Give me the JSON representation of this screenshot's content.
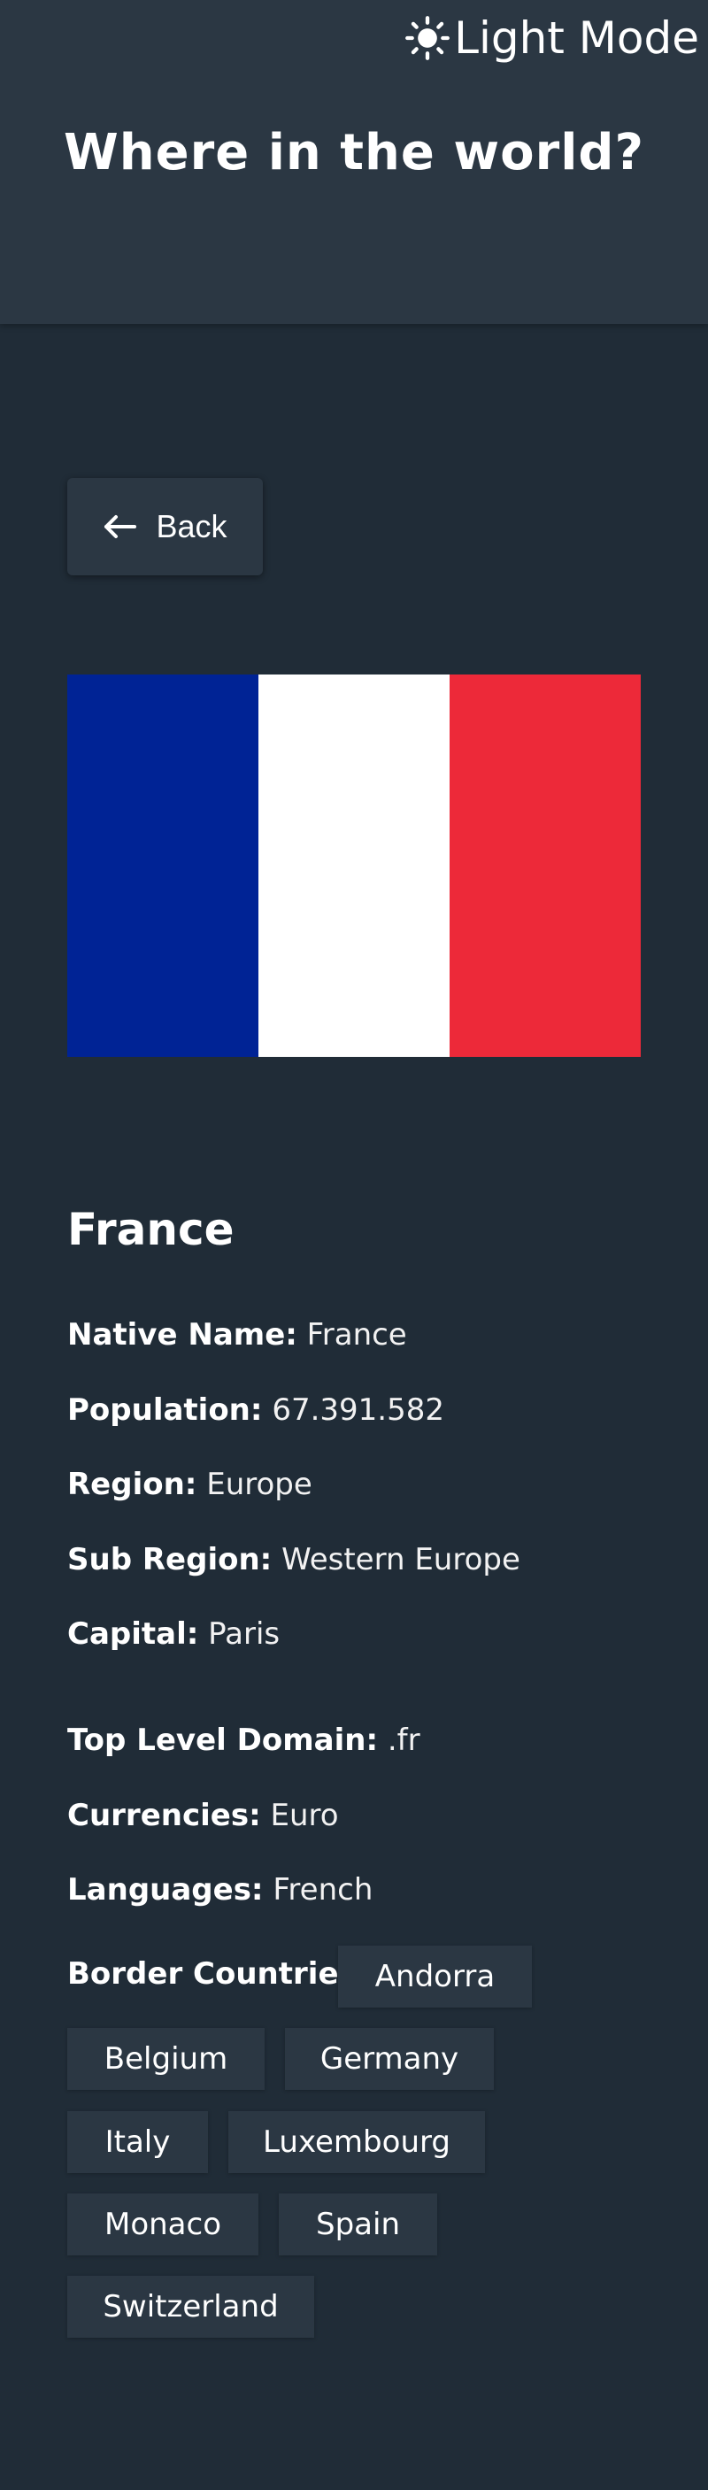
{
  "header": {
    "theme_toggle_label": "Light Mode",
    "title": "Where in the world?"
  },
  "back_button": {
    "label": "Back"
  },
  "flag": {
    "colors": [
      "#002395",
      "#ffffff",
      "#ed2939"
    ]
  },
  "country": {
    "name": "France",
    "details": [
      {
        "label": "Native Name:",
        "value": "France"
      },
      {
        "label": "Population:",
        "value": "67.391.582"
      },
      {
        "label": "Region:",
        "value": "Europe"
      },
      {
        "label": "Sub Region:",
        "value": "Western Europe"
      },
      {
        "label": "Capital:",
        "value": "Paris"
      },
      {
        "label": "Top Level Domain:",
        "value": ".fr"
      },
      {
        "label": "Currencies:",
        "value": "Euro"
      },
      {
        "label": "Languages:",
        "value": "French"
      }
    ],
    "border_countries_label": "Border Countries:",
    "border_countries": [
      "Andorra",
      "Belgium",
      "Germany",
      "Italy",
      "Luxembourg",
      "Monaco",
      "Spain",
      "Switzerland"
    ]
  },
  "colors": {
    "background": "#202c37",
    "element": "#2b3743",
    "text": "#ffffff"
  }
}
